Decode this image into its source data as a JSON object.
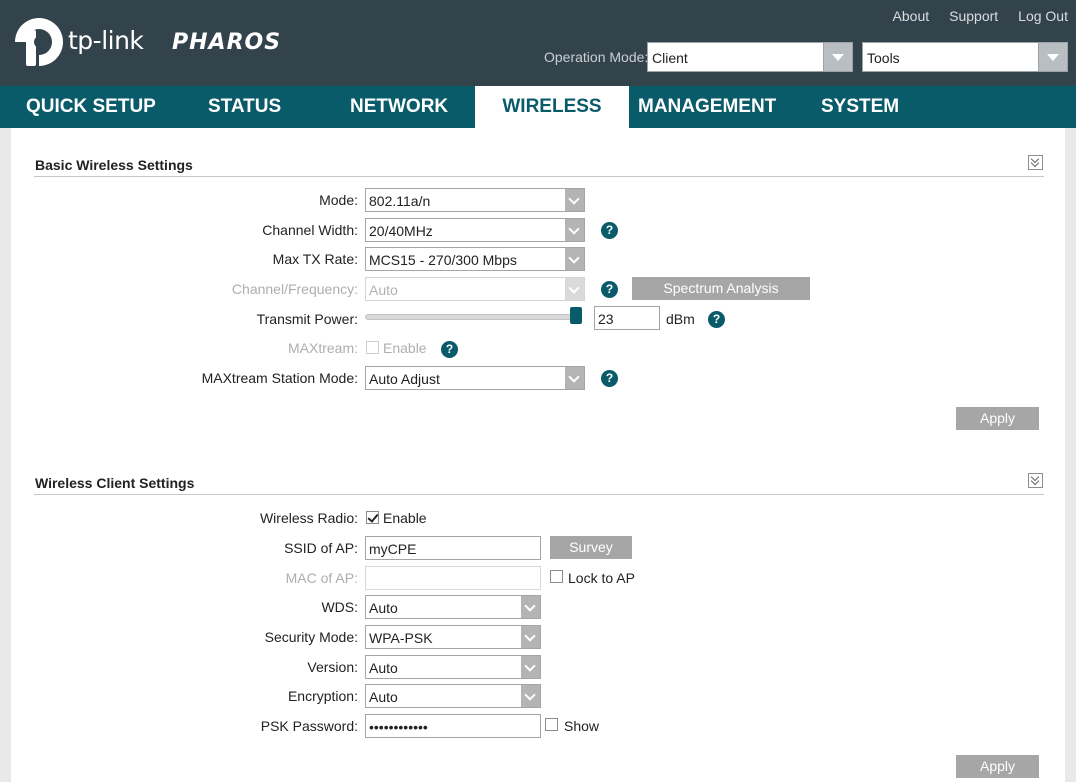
{
  "brand": {
    "name": "tp-link",
    "product": "PHAROS"
  },
  "top_links": [
    "About",
    "Support",
    "Log Out"
  ],
  "header": {
    "operation_mode_label": "Operation Mode:",
    "operation_mode_value": "Client",
    "tools_value": "Tools"
  },
  "nav": {
    "tabs": [
      "QUICK SETUP",
      "STATUS",
      "NETWORK",
      "WIRELESS",
      "MANAGEMENT",
      "SYSTEM"
    ],
    "active": "WIRELESS"
  },
  "basic": {
    "title": "Basic Wireless Settings",
    "mode_label": "Mode:",
    "mode_value": "802.11a/n",
    "channel_width_label": "Channel Width:",
    "channel_width_value": "20/40MHz",
    "max_tx_label": "Max TX Rate:",
    "max_tx_value": "MCS15 - 270/300 Mbps",
    "channel_freq_label": "Channel/Frequency:",
    "channel_freq_value": "Auto",
    "spectrum_button": "Spectrum Analysis",
    "transmit_power_label": "Transmit Power:",
    "transmit_power_value": "23",
    "transmit_power_unit": "dBm",
    "maxtream_label": "MAXtream:",
    "maxtream_enable": "Enable",
    "maxtream_station_label": "MAXtream Station Mode:",
    "maxtream_station_value": "Auto Adjust",
    "apply": "Apply"
  },
  "client": {
    "title": "Wireless Client Settings",
    "radio_label": "Wireless Radio:",
    "radio_enable": "Enable",
    "ssid_label": "SSID of AP:",
    "ssid_value": "myCPE",
    "survey_button": "Survey",
    "mac_label": "MAC of AP:",
    "mac_value": "",
    "lock_label": "Lock to AP",
    "wds_label": "WDS:",
    "wds_value": "Auto",
    "security_label": "Security Mode:",
    "security_value": "WPA-PSK",
    "version_label": "Version:",
    "version_value": "Auto",
    "encryption_label": "Encryption:",
    "encryption_value": "Auto",
    "psk_label": "PSK Password:",
    "psk_value": "••••••••••••",
    "show_label": "Show",
    "apply": "Apply"
  },
  "colors": {
    "header": "#33434b",
    "nav": "#0a5b6a",
    "accent": "#0a5b6a",
    "button": "#a6a6a6"
  }
}
